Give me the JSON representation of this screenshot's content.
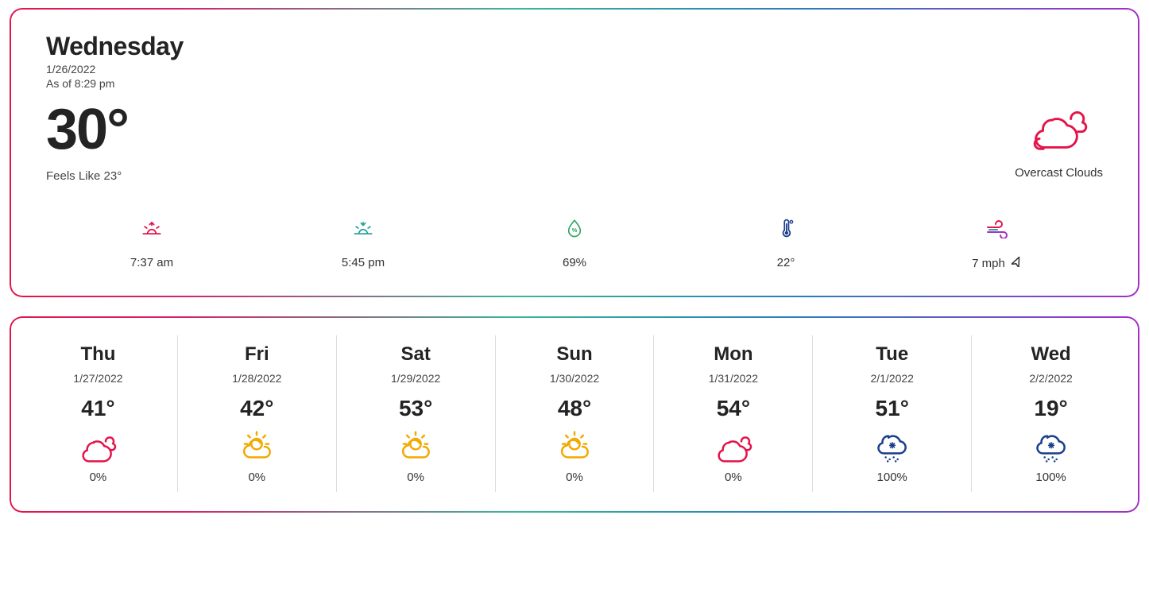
{
  "today": {
    "day_name": "Wednesday",
    "date": "1/26/2022",
    "as_of": "As of 8:29 pm",
    "temp": "30°",
    "feels_like": "Feels Like 23°",
    "condition": "Overcast Clouds",
    "condition_icon": "overcast-clouds-icon",
    "metrics": {
      "sunrise": "7:37 am",
      "sunset": "5:45 pm",
      "humidity": "69%",
      "dew_point": "22°",
      "wind": "7 mph"
    }
  },
  "forecast": [
    {
      "day": "Thu",
      "date": "1/27/2022",
      "temp": "41°",
      "icon": "scattered-clouds-icon",
      "icon_color": "#e4144b",
      "precip": "0%"
    },
    {
      "day": "Fri",
      "date": "1/28/2022",
      "temp": "42°",
      "icon": "few-clouds-icon",
      "icon_color": "#f2a900",
      "precip": "0%"
    },
    {
      "day": "Sat",
      "date": "1/29/2022",
      "temp": "53°",
      "icon": "few-clouds-icon",
      "icon_color": "#f2a900",
      "precip": "0%"
    },
    {
      "day": "Sun",
      "date": "1/30/2022",
      "temp": "48°",
      "icon": "few-clouds-icon",
      "icon_color": "#f2a900",
      "precip": "0%"
    },
    {
      "day": "Mon",
      "date": "1/31/2022",
      "temp": "54°",
      "icon": "scattered-clouds-icon",
      "icon_color": "#e4144b",
      "precip": "0%"
    },
    {
      "day": "Tue",
      "date": "2/1/2022",
      "temp": "51°",
      "icon": "snow-icon",
      "icon_color": "#1b3f8b",
      "precip": "100%"
    },
    {
      "day": "Wed",
      "date": "2/2/2022",
      "temp": "19°",
      "icon": "snow-icon",
      "icon_color": "#1b3f8b",
      "precip": "100%"
    }
  ],
  "colors": {
    "pink": "#e4144b",
    "teal": "#2aa59a",
    "green": "#2aa65f",
    "blue": "#1b3f8b",
    "purple": "#a32fc6",
    "yellow": "#f2a900"
  }
}
